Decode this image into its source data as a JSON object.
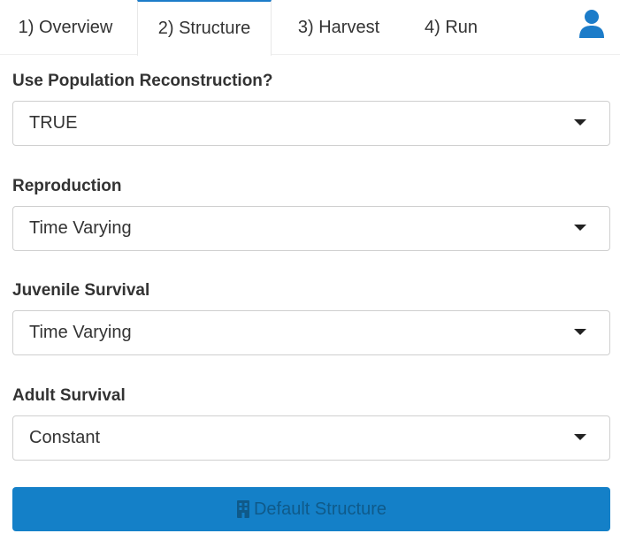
{
  "tabs": [
    {
      "label": "1) Overview"
    },
    {
      "label": "2) Structure"
    },
    {
      "label": "3) Harvest"
    },
    {
      "label": "4) Run"
    }
  ],
  "active_tab": "2) Structure",
  "fields": [
    {
      "label": "Use Population Reconstruction?",
      "value": "TRUE"
    },
    {
      "label": "Reproduction",
      "value": "Time Varying"
    },
    {
      "label": "Juvenile Survival",
      "value": "Time Varying"
    },
    {
      "label": "Adult Survival",
      "value": "Constant"
    }
  ],
  "button": {
    "label": "Default Structure",
    "icon": "building-icon"
  },
  "colors": {
    "accent": "#1480c8",
    "icon_blue": "#1c7cc9"
  }
}
